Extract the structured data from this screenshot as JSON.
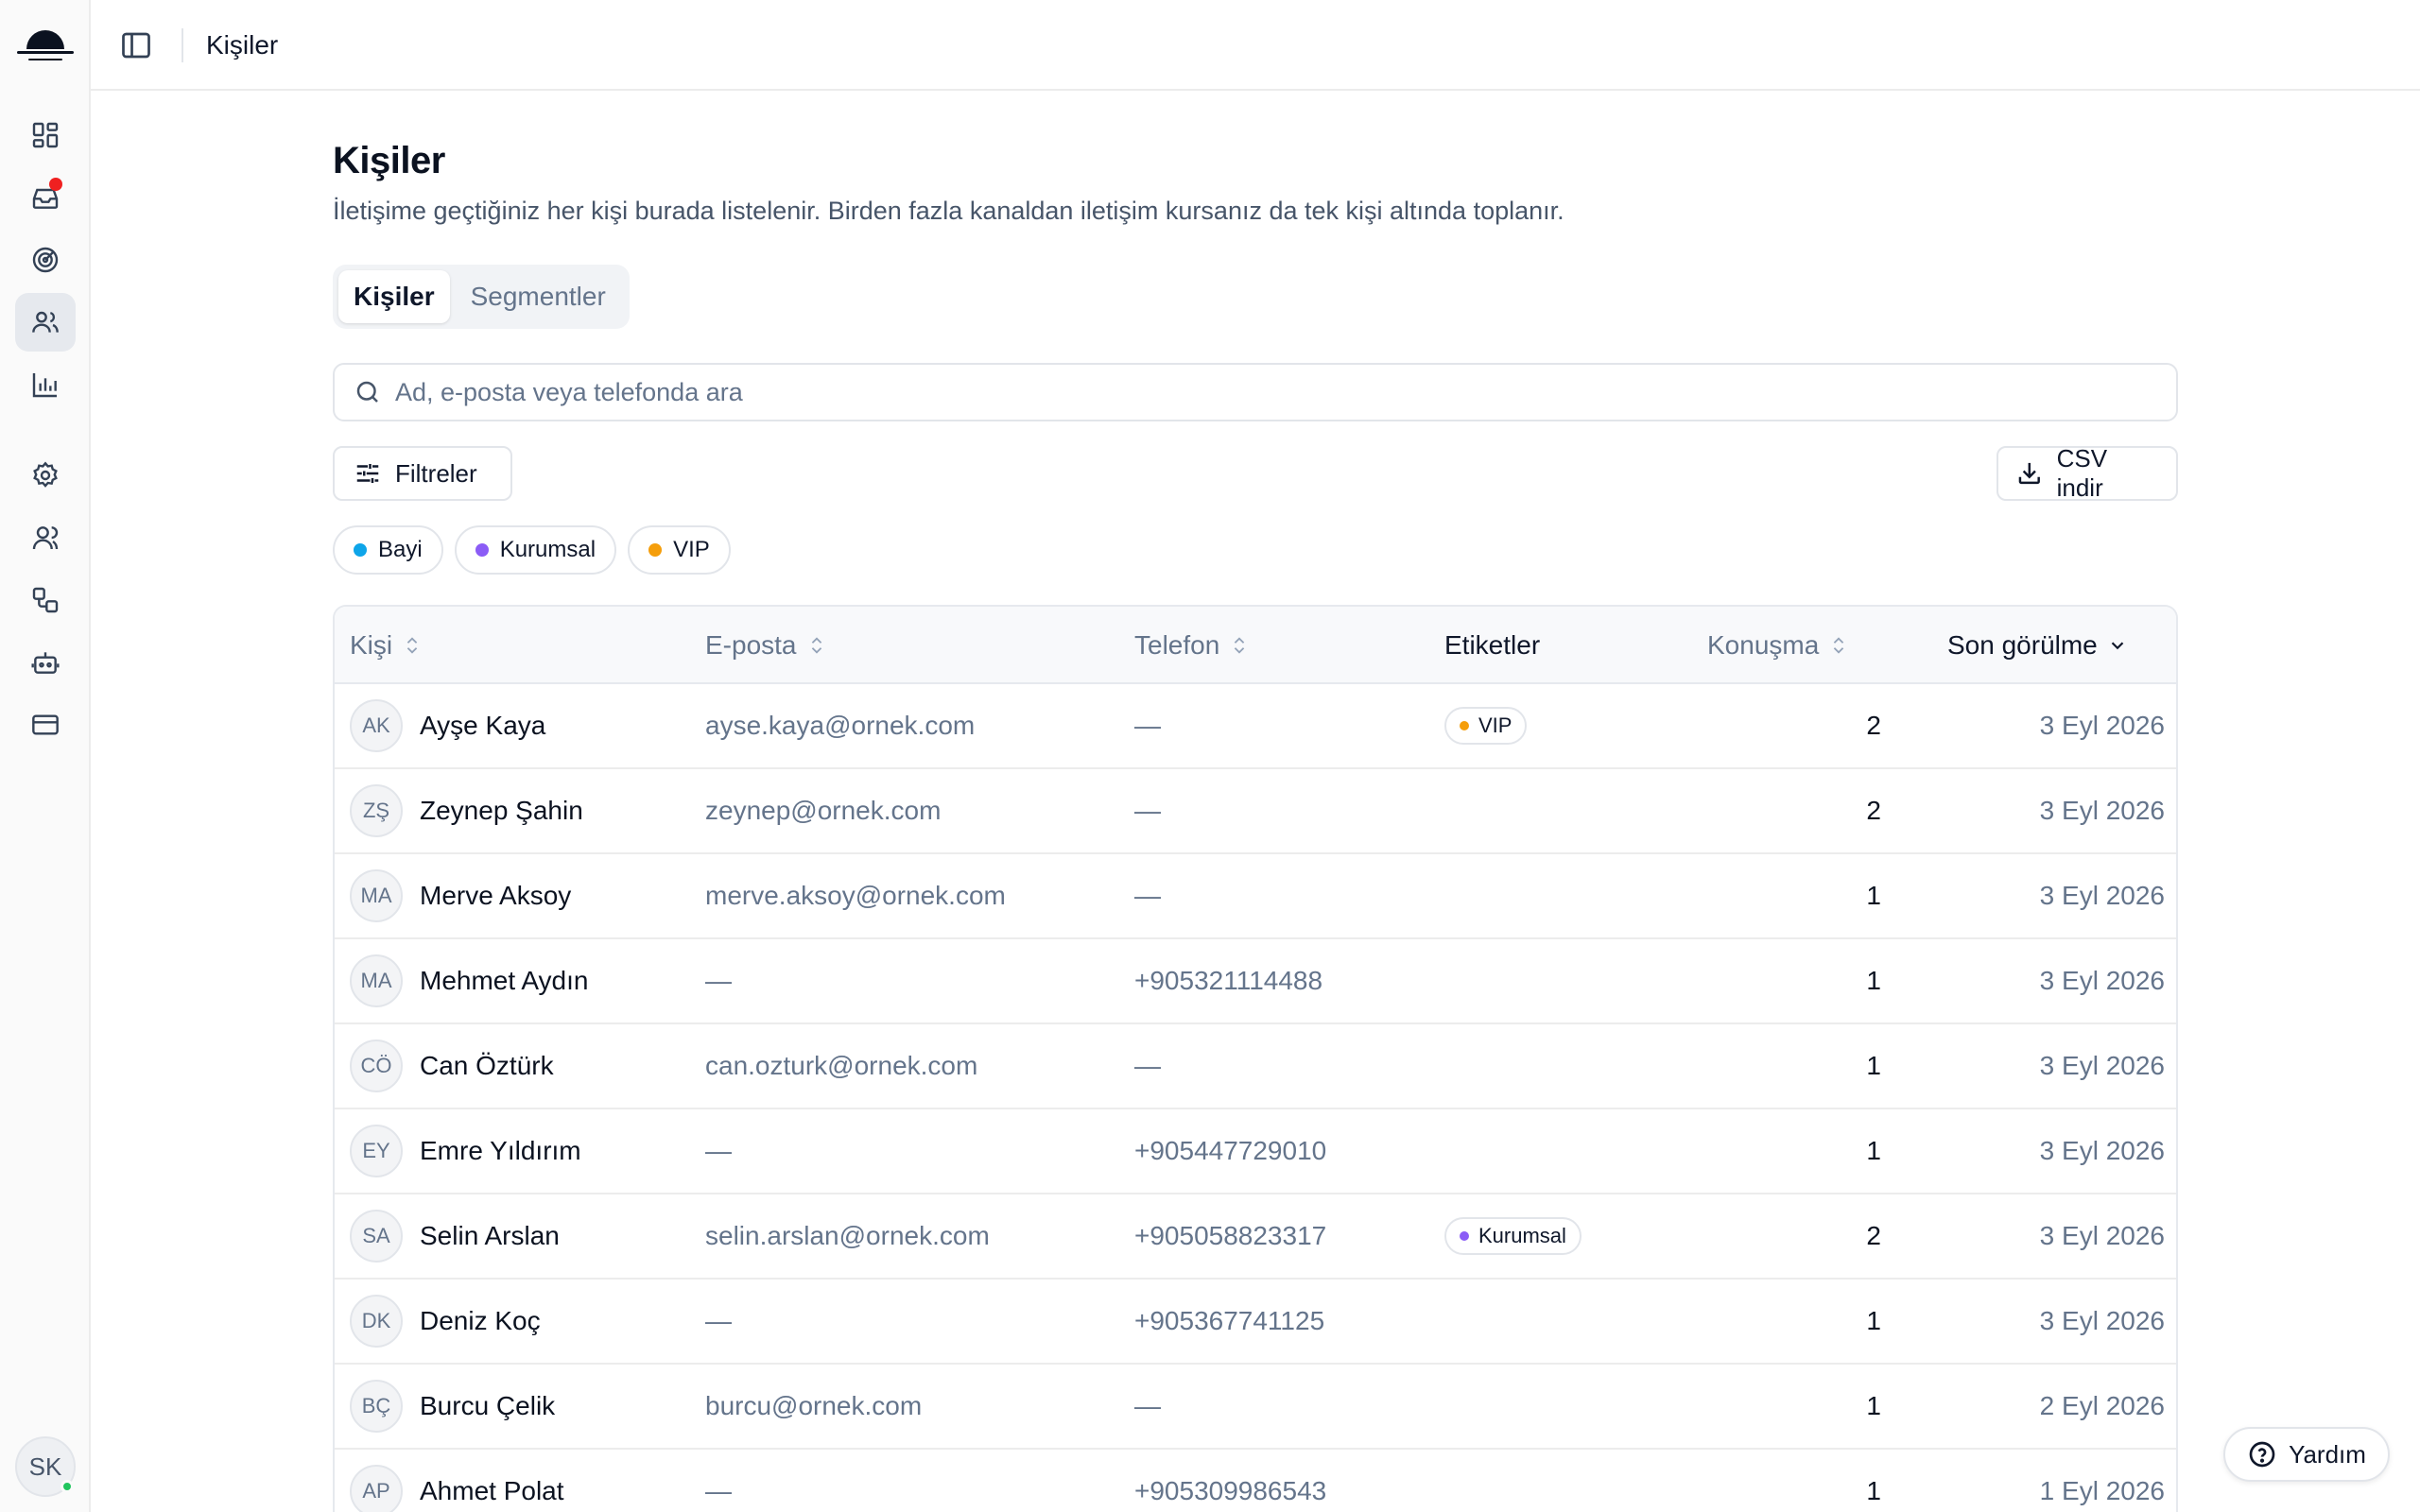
{
  "topbar": {
    "breadcrumb": "Kişiler"
  },
  "sidebar": {
    "nav": [
      {
        "icon": "dashboard-icon"
      },
      {
        "icon": "inbox-icon",
        "has_notification": true
      },
      {
        "icon": "target-icon"
      },
      {
        "icon": "users-icon",
        "active": true
      },
      {
        "icon": "bar-chart-icon"
      },
      {
        "icon": "gear-icon"
      },
      {
        "icon": "team-icon"
      },
      {
        "icon": "integrations-icon"
      },
      {
        "icon": "bot-icon"
      },
      {
        "icon": "credit-card-icon"
      }
    ],
    "user_initials": "SK"
  },
  "page": {
    "title": "Kişiler",
    "description": "İletişime geçtiğiniz her kişi burada listelenir. Birden fazla kanaldan iletişim kursanız da tek kişi altında toplanır.",
    "tabs": [
      {
        "label": "Kişiler",
        "active": true
      },
      {
        "label": "Segmentler",
        "active": false
      }
    ],
    "search_placeholder": "Ad, e-posta veya telefonda ara",
    "filter_label": "Filtreler",
    "csv_label": "CSV indir",
    "chips": [
      {
        "label": "Bayi",
        "color": "#0ea5e9"
      },
      {
        "label": "Kurumsal",
        "color": "#8b5cf6"
      },
      {
        "label": "VIP",
        "color": "#f59e0b"
      }
    ]
  },
  "table": {
    "columns": {
      "person": "Kişi",
      "email": "E-posta",
      "phone": "Telefon",
      "tags": "Etiketler",
      "conversations": "Konuşma",
      "last_seen": "Son görülme"
    },
    "rows": [
      {
        "initials": "AK",
        "name": "Ayşe Kaya",
        "email": "ayse.kaya@ornek.com",
        "phone": "—",
        "tag": "VIP",
        "tag_color": "#f59e0b",
        "conversations": "2",
        "last_seen": "3 Eyl 2026"
      },
      {
        "initials": "ZŞ",
        "name": "Zeynep Şahin",
        "email": "zeynep@ornek.com",
        "phone": "—",
        "tag": "",
        "tag_color": "",
        "conversations": "2",
        "last_seen": "3 Eyl 2026"
      },
      {
        "initials": "MA",
        "name": "Merve Aksoy",
        "email": "merve.aksoy@ornek.com",
        "phone": "—",
        "tag": "",
        "tag_color": "",
        "conversations": "1",
        "last_seen": "3 Eyl 2026"
      },
      {
        "initials": "MA",
        "name": "Mehmet Aydın",
        "email": "—",
        "phone": "+905321114488",
        "tag": "",
        "tag_color": "",
        "conversations": "1",
        "last_seen": "3 Eyl 2026"
      },
      {
        "initials": "CÖ",
        "name": "Can Öztürk",
        "email": "can.ozturk@ornek.com",
        "phone": "—",
        "tag": "",
        "tag_color": "",
        "conversations": "1",
        "last_seen": "3 Eyl 2026"
      },
      {
        "initials": "EY",
        "name": "Emre Yıldırım",
        "email": "—",
        "phone": "+905447729010",
        "tag": "",
        "tag_color": "",
        "conversations": "1",
        "last_seen": "3 Eyl 2026"
      },
      {
        "initials": "SA",
        "name": "Selin Arslan",
        "email": "selin.arslan@ornek.com",
        "phone": "+905058823317",
        "tag": "Kurumsal",
        "tag_color": "#8b5cf6",
        "conversations": "2",
        "last_seen": "3 Eyl 2026"
      },
      {
        "initials": "DK",
        "name": "Deniz Koç",
        "email": "—",
        "phone": "+905367741125",
        "tag": "",
        "tag_color": "",
        "conversations": "1",
        "last_seen": "3 Eyl 2026"
      },
      {
        "initials": "BÇ",
        "name": "Burcu Çelik",
        "email": "burcu@ornek.com",
        "phone": "—",
        "tag": "",
        "tag_color": "",
        "conversations": "1",
        "last_seen": "2 Eyl 2026"
      },
      {
        "initials": "AP",
        "name": "Ahmet Polat",
        "email": "—",
        "phone": "+905309986543",
        "tag": "",
        "tag_color": "",
        "conversations": "1",
        "last_seen": "1 Eyl 2026"
      }
    ]
  },
  "help": {
    "label": "Yardım"
  }
}
